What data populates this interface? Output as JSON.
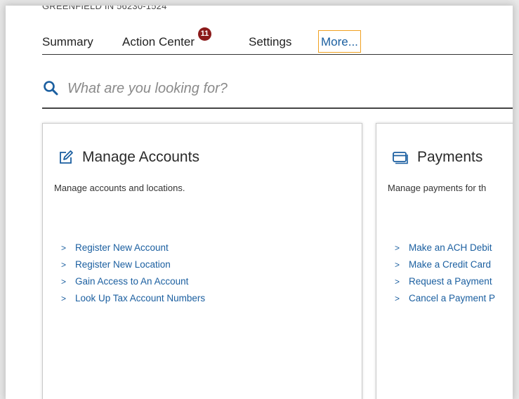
{
  "header": {
    "address": "GREENFIELD IN 56230-1524"
  },
  "tabs": {
    "summary": "Summary",
    "action_center": "Action Center",
    "action_center_badge": "11",
    "settings": "Settings",
    "more": "More..."
  },
  "search": {
    "placeholder": "What are you looking for?"
  },
  "cards": {
    "manage": {
      "icon": "edit-icon",
      "title": "Manage Accounts",
      "description": "Manage accounts and locations.",
      "links": [
        "Register New Account",
        "Register New Location",
        "Gain Access to An Account",
        "Look Up Tax Account Numbers"
      ]
    },
    "payments": {
      "icon": "credit-card-icon",
      "title": "Payments",
      "description": "Manage payments for th",
      "links": [
        "Make an ACH Debit",
        "Make a Credit Card",
        "Request a Payment",
        "Cancel a Payment P"
      ]
    }
  },
  "colors": {
    "link": "#1b5fa0",
    "badge": "#8b1a1a",
    "focus": "#f0a020"
  }
}
